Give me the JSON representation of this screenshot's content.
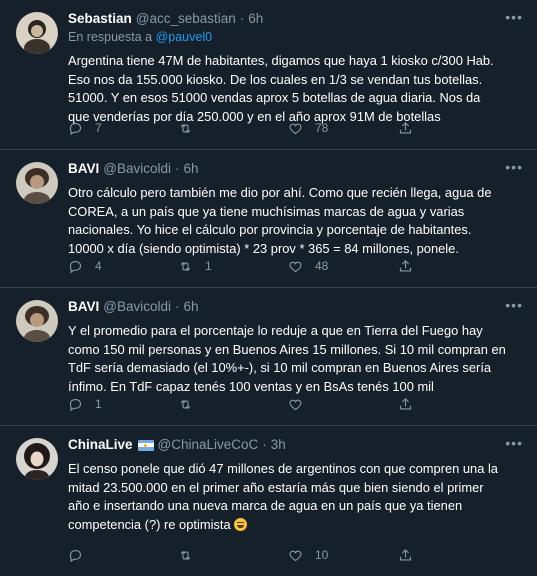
{
  "tweets": [
    {
      "name": "Sebastian",
      "handle": "@acc_sebastian",
      "sep": "·",
      "time": "6h",
      "reply_prefix": "En respuesta a",
      "reply_user": "@pauvel0",
      "lines": [
        "Argentina tiene 47M de habitantes, digamos que haya 1 kiosko c/300 Hab.",
        "Eso nos da 155.000 kiosko. De los cuales en 1/3 se vendan tus botellas.",
        "51000. Y en esos 51000 vendas aprox 5 botellas de agua diaria. Nos da",
        "que venderías por día 250.000 y en el año aprox 91M de botellas"
      ],
      "replies": "7",
      "retweets": "",
      "likes": "78"
    },
    {
      "name": "BAVI",
      "handle": "@Bavicoldi",
      "sep": "·",
      "time": "6h",
      "lines": [
        "Otro cálculo pero también me dio por ahí. Como que recién llega, agua de",
        "COREA, a un país que ya tiene muchísimas marcas de agua y varias",
        "nacionales. Yo hice el cálculo por provincia y porcentaje de habitantes.",
        "10000 x día (siendo optimista) * 23 prov * 365 = 84 millones, ponele."
      ],
      "replies": "4",
      "retweets": "1",
      "likes": "48"
    },
    {
      "name": "BAVI",
      "handle": "@Bavicoldi",
      "sep": "·",
      "time": "6h",
      "lines": [
        "Y el promedio para el porcentaje lo reduje a que en Tierra del Fuego hay",
        "como 150 mil personas y en Buenos Aires 15 millones. Si 10 mil compran en",
        "TdF sería demasiado (el 10%+-), si 10 mil compran en Buenos Aires sería",
        "ínfimo. En TdF capaz tenés 100 ventas y en BsAs tenés 100 mil"
      ],
      "replies": "1",
      "retweets": "",
      "likes": ""
    },
    {
      "name": "ChinaLive",
      "handle": "@ChinaLiveCoC",
      "sep": "·",
      "time": "3h",
      "lines": [
        "El censo ponele que dió 47 millones de argentinos con que compren una la",
        "mitad 23.500.000 en el primer año estaría más que bien siendo el primer",
        "año e insertando una nueva marca de agua en un país que ya tienen",
        "competencia (?)  re optimista"
      ],
      "replies": "",
      "retweets": "",
      "likes": "10"
    }
  ],
  "icons": {
    "reply": "reply-icon",
    "retweet": "retweet-icon",
    "like": "heart-icon",
    "share": "share-icon",
    "more": "more-icon"
  },
  "colors": {
    "background": "#15202b",
    "secondary_text": "#8899a6",
    "link": "#1d9bf0",
    "divider": "#38444d"
  }
}
